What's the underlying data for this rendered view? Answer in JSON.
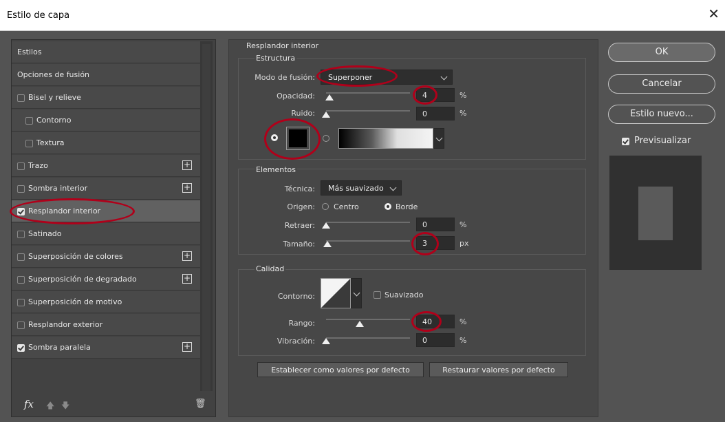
{
  "window": {
    "title": "Estilo de capa",
    "close_glyph": "✕"
  },
  "styles_list": {
    "header": "Estilos",
    "items": [
      {
        "label": "Opciones de fusión",
        "checkbox": false,
        "checked": false,
        "plus": false,
        "indent": 0
      },
      {
        "label": "Bisel y relieve",
        "checkbox": true,
        "checked": false,
        "plus": false,
        "indent": 0
      },
      {
        "label": "Contorno",
        "checkbox": true,
        "checked": false,
        "plus": false,
        "indent": 1
      },
      {
        "label": "Textura",
        "checkbox": true,
        "checked": false,
        "plus": false,
        "indent": 1
      },
      {
        "label": "Trazo",
        "checkbox": true,
        "checked": false,
        "plus": true,
        "indent": 0
      },
      {
        "label": "Sombra interior",
        "checkbox": true,
        "checked": false,
        "plus": true,
        "indent": 0
      },
      {
        "label": "Resplandor interior",
        "checkbox": true,
        "checked": true,
        "plus": false,
        "indent": 0,
        "selected": true
      },
      {
        "label": "Satinado",
        "checkbox": true,
        "checked": false,
        "plus": false,
        "indent": 0
      },
      {
        "label": "Superposición de colores",
        "checkbox": true,
        "checked": false,
        "plus": true,
        "indent": 0
      },
      {
        "label": "Superposición de degradado",
        "checkbox": true,
        "checked": false,
        "plus": true,
        "indent": 0
      },
      {
        "label": "Superposición de motivo",
        "checkbox": true,
        "checked": false,
        "plus": false,
        "indent": 0
      },
      {
        "label": "Resplandor exterior",
        "checkbox": true,
        "checked": false,
        "plus": false,
        "indent": 0
      },
      {
        "label": "Sombra paralela",
        "checkbox": true,
        "checked": true,
        "plus": true,
        "indent": 0
      }
    ],
    "footer": {
      "fx": "fx",
      "up": "🡅",
      "down": "🡇",
      "trash": "🗑"
    }
  },
  "panel": {
    "title": "Resplandor interior",
    "estructura": {
      "title": "Estructura",
      "modo_label": "Modo de fusión:",
      "modo_value": "Superponer",
      "opacidad_label": "Opacidad:",
      "opacidad_value": "4",
      "opacidad_unit": "%",
      "opacidad_fraction": 0.04,
      "ruido_label": "Ruido:",
      "ruido_value": "0",
      "ruido_unit": "%",
      "ruido_fraction": 0.0,
      "color": "#000000"
    },
    "elementos": {
      "title": "Elementos",
      "tecnica_label": "Técnica:",
      "tecnica_value": "Más suavizado",
      "origen_label": "Origen:",
      "origen_centro": "Centro",
      "origen_borde": "Borde",
      "retraer_label": "Retraer:",
      "retraer_value": "0",
      "retraer_unit": "%",
      "tamano_label": "Tamaño:",
      "tamano_value": "3",
      "tamano_unit": "px"
    },
    "calidad": {
      "title": "Calidad",
      "contorno_label": "Contorno:",
      "suavizado_label": "Suavizado",
      "rango_label": "Rango:",
      "rango_value": "40",
      "rango_unit": "%",
      "rango_fraction": 0.4,
      "vibracion_label": "Vibración:",
      "vibracion_value": "0",
      "vibracion_unit": "%"
    },
    "default_btn": "Establecer como valores por defecto",
    "restore_btn": "Restaurar valores por defecto"
  },
  "right": {
    "ok": "OK",
    "cancel": "Cancelar",
    "new_style": "Estilo nuevo...",
    "preview_label": "Previsualizar",
    "preview_checked": true
  }
}
